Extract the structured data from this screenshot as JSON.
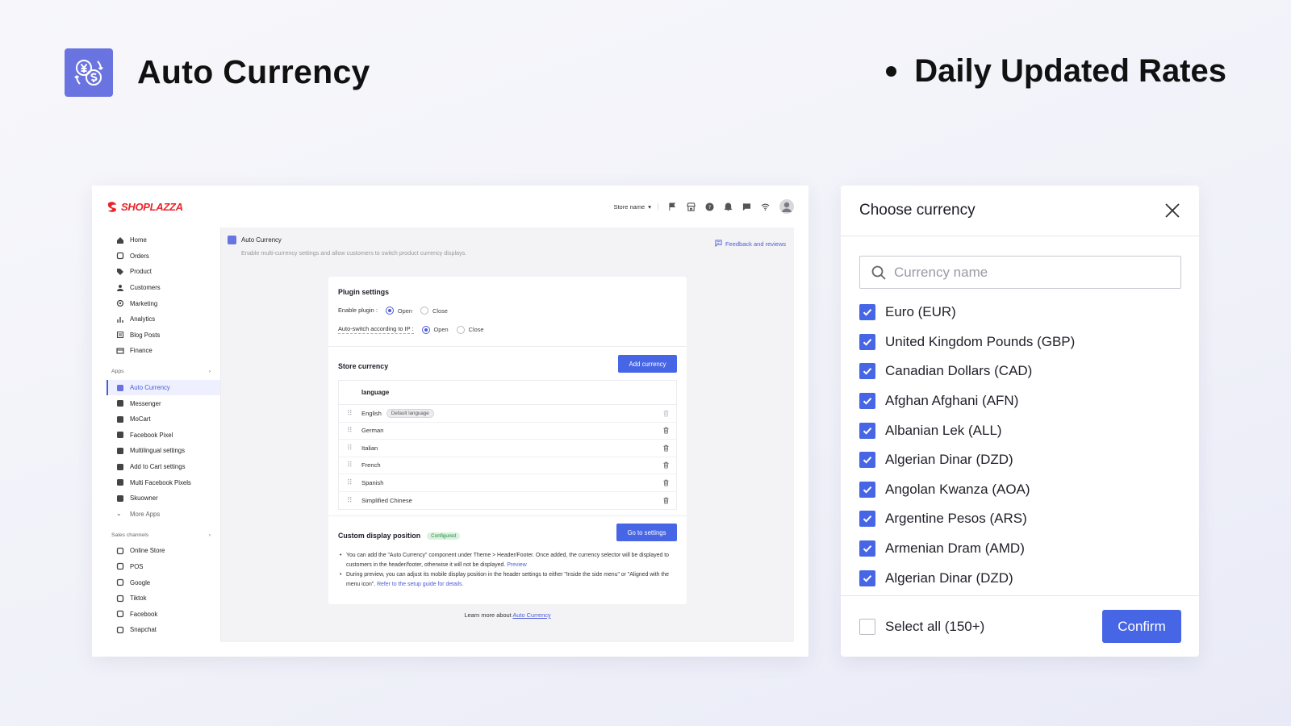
{
  "hero": {
    "title": "Auto Currency",
    "feature": "Daily Updated Rates",
    "logo_icon": "currency-exchange-icon",
    "accent": "#6a74e0"
  },
  "admin": {
    "brand": "SHOPLAZZA",
    "store_selector": "Store name",
    "sidebar": {
      "main_items": [
        {
          "label": "Home",
          "icon": "home-icon"
        },
        {
          "label": "Orders",
          "icon": "orders-icon"
        },
        {
          "label": "Product",
          "icon": "tag-icon"
        },
        {
          "label": "Customers",
          "icon": "person-icon"
        },
        {
          "label": "Marketing",
          "icon": "marketing-icon"
        },
        {
          "label": "Analytics",
          "icon": "chart-icon"
        },
        {
          "label": "Blog Posts",
          "icon": "blog-icon"
        },
        {
          "label": "Finance",
          "icon": "finance-icon"
        }
      ],
      "apps_label": "Apps",
      "apps": [
        {
          "label": "Auto Currency",
          "active": true
        },
        {
          "label": "Messenger"
        },
        {
          "label": "MoCart"
        },
        {
          "label": "Facebook Pixel"
        },
        {
          "label": "Multilingual settings"
        },
        {
          "label": "Add to Cart settings"
        },
        {
          "label": "Multi Facebook Pixels"
        },
        {
          "label": "Skuowner"
        }
      ],
      "more_apps": "More Apps",
      "channels_label": "Sales channels",
      "channels": [
        {
          "label": "Online Store"
        },
        {
          "label": "POS"
        },
        {
          "label": "Google"
        },
        {
          "label": "Tiktok"
        },
        {
          "label": "Facebook"
        },
        {
          "label": "Snapchat"
        }
      ]
    },
    "page": {
      "title": "Auto Currency",
      "description": "Enable multi-currency settings and allow customers to switch product currency displays.",
      "feedback": "Feedback and reviews"
    },
    "plugin": {
      "title": "Plugin settings",
      "enable_label": "Enable plugin :",
      "auto_switch_label": "Auto-switch according to IP :",
      "open": "Open",
      "close": "Close"
    },
    "store_currency": {
      "title": "Store currency",
      "add_button": "Add currency",
      "column_header": "language",
      "default_badge": "Default language",
      "rows": [
        "English",
        "German",
        "Italian",
        "French",
        "Spanish",
        "Simplified Chinese"
      ]
    },
    "custom_display": {
      "title": "Custom display position",
      "badge": "Configured",
      "button": "Go to settings",
      "note1": "You can add the \"Auto Currency\" component under Theme > Header/Footer. Once added, the currency selector will be displayed to customers in the header/footer, otherwise it will not be displayed.",
      "note1_link": "Preview",
      "note2": "During preview, you can adjust its mobile display position in the header settings to either \"Inside the side menu\" or \"Aligned with the menu icon\".",
      "note2_link": "Refer to the setup guide for details."
    },
    "learn_more": "Learn more about",
    "learn_more_link": "Auto Currency"
  },
  "modal": {
    "title": "Choose currency",
    "search_placeholder": "Currency name",
    "items": [
      "Euro (EUR)",
      "United Kingdom Pounds (GBP)",
      "Canadian Dollars (CAD)",
      "Afghan Afghani (AFN)",
      "Albanian Lek (ALL)",
      "Algerian Dinar (DZD)",
      "Angolan Kwanza (AOA)",
      "Argentine Pesos (ARS)",
      "Armenian Dram (AMD)",
      "Algerian Dinar (DZD)"
    ],
    "select_all": "Select all (150+)",
    "confirm": "Confirm",
    "checkbox_color": "#4766e6"
  }
}
